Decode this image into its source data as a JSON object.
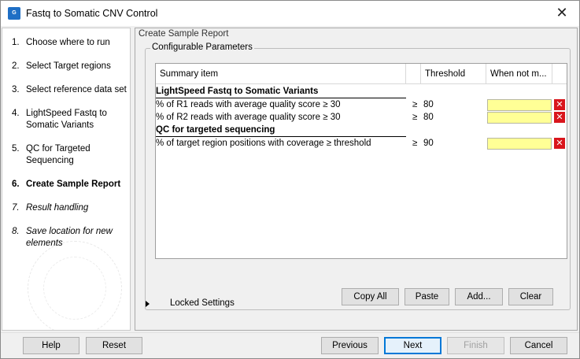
{
  "window": {
    "title": "Fastq to Somatic CNV Control",
    "app_icon": "clc-app-icon",
    "app_icon_text": "G",
    "close_glyph": "✕"
  },
  "steps": [
    {
      "num": "1.",
      "label": "Choose where to run",
      "state": "done"
    },
    {
      "num": "2.",
      "label": "Select Target regions",
      "state": "done"
    },
    {
      "num": "3.",
      "label": "Select reference data set",
      "state": "done"
    },
    {
      "num": "4.",
      "label": "LightSpeed Fastq to Somatic Variants",
      "state": "done"
    },
    {
      "num": "5.",
      "label": "QC for Targeted Sequencing",
      "state": "done"
    },
    {
      "num": "6.",
      "label": "Create Sample Report",
      "state": "active"
    },
    {
      "num": "7.",
      "label": "Result handling",
      "state": "future"
    },
    {
      "num": "8.",
      "label": "Save location for new elements",
      "state": "future"
    }
  ],
  "pane": {
    "header": "Create Sample Report",
    "group_title": "Configurable Parameters",
    "columns": [
      "Summary item",
      "Threshold",
      "When not m..."
    ],
    "sections": [
      {
        "title": "LightSpeed Fastq to Somatic Variants",
        "rows": [
          {
            "label": "% of R1 reads with average quality score ≥ 30",
            "op": "≥",
            "threshold": "80",
            "when_not_met": ""
          },
          {
            "label": "% of R2 reads with average quality score ≥ 30",
            "op": "≥",
            "threshold": "80",
            "when_not_met": ""
          }
        ]
      },
      {
        "title": "QC for targeted sequencing",
        "rows": [
          {
            "label": "% of target region positions with coverage ≥ threshold",
            "op": "≥",
            "threshold": "90",
            "when_not_met": ""
          }
        ]
      }
    ],
    "delete_glyph": "✕",
    "table_buttons": {
      "copy_all": "Copy All",
      "paste": "Paste",
      "add": "Add...",
      "clear": "Clear"
    },
    "locked_settings": "Locked Settings"
  },
  "footer": {
    "help": "Help",
    "reset": "Reset",
    "previous": "Previous",
    "next": "Next",
    "finish": "Finish",
    "cancel": "Cancel"
  },
  "colors": {
    "input_bg": "#ffff96",
    "delete_red": "#d9151c",
    "default_button_border": "#0078d7"
  }
}
